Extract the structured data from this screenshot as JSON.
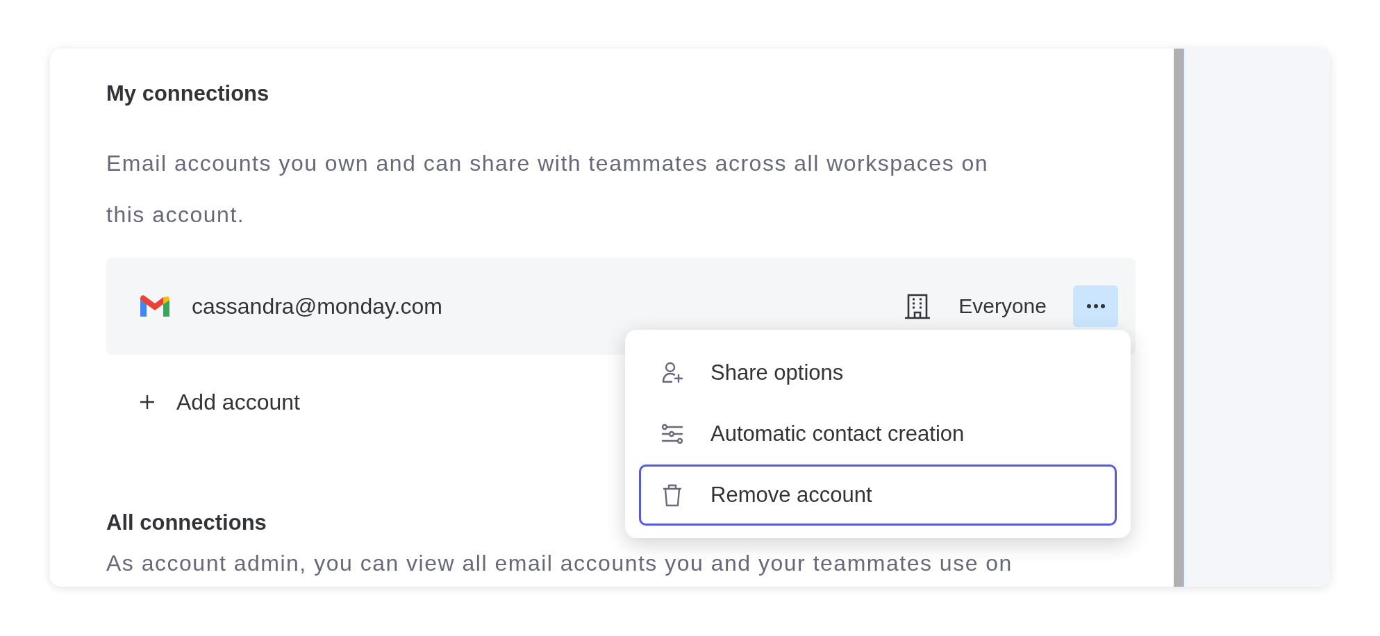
{
  "my_connections": {
    "title": "My connections",
    "description": "Email accounts you own and can share with teammates across all workspaces on this account."
  },
  "accounts": [
    {
      "email": "cassandra@monday.com",
      "visibility": "Everyone",
      "menu_open": true
    }
  ],
  "add_account": {
    "label": "Add account"
  },
  "menu": [
    {
      "kind": "share",
      "label": "Share options",
      "focused": false
    },
    {
      "kind": "settings",
      "label": "Automatic contact creation",
      "focused": false
    },
    {
      "kind": "remove",
      "label": "Remove account",
      "focused": true
    }
  ],
  "all_connections": {
    "title": "All connections",
    "description": "As account admin, you can view all email accounts you and your teammates use on"
  }
}
